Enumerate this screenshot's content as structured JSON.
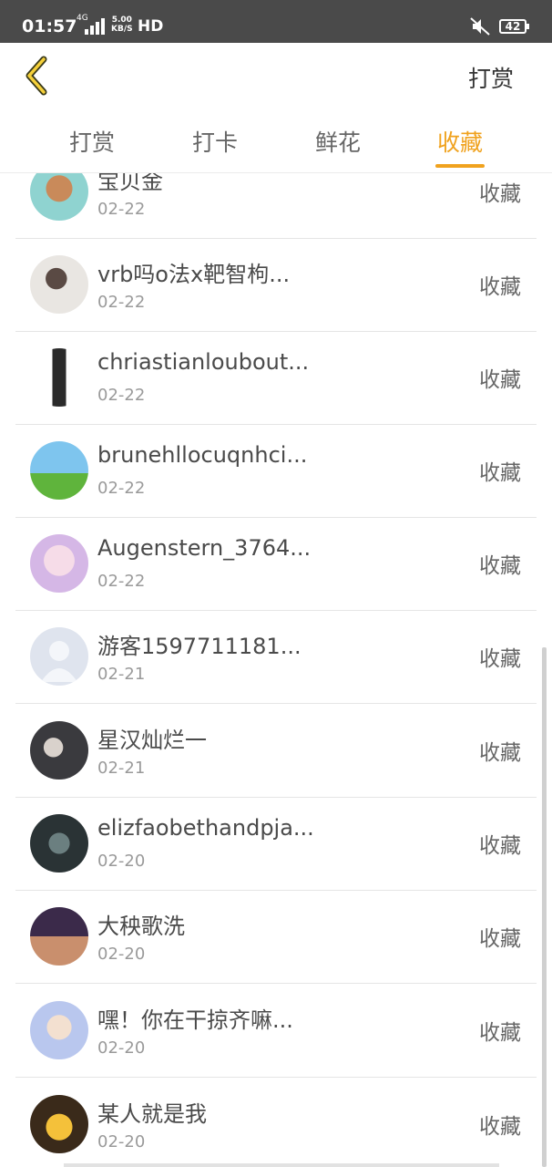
{
  "status_bar": {
    "time": "01:57",
    "network": "4G",
    "speed_top": "5.00",
    "speed_bottom": "KB/S",
    "hd": "HD",
    "battery": "42"
  },
  "header": {
    "back_icon": "chevron-left-icon",
    "title": "打赏"
  },
  "tabs": [
    {
      "label": "打赏",
      "active": false
    },
    {
      "label": "打卡",
      "active": false
    },
    {
      "label": "鲜花",
      "active": false
    },
    {
      "label": "收藏",
      "active": true
    }
  ],
  "colors": {
    "accent": "#f0a21e",
    "status_bar": "#4a4a4a"
  },
  "list": [
    {
      "name": "宝贝金",
      "date": "02-22",
      "action": "收藏"
    },
    {
      "name": "vrb吗o法x靶智枸...",
      "date": "02-22",
      "action": "收藏"
    },
    {
      "name": "chriastianloubout...",
      "date": "02-22",
      "action": "收藏"
    },
    {
      "name": "brunehllocuqnhci...",
      "date": "02-22",
      "action": "收藏"
    },
    {
      "name": "Augenstern_3764...",
      "date": "02-22",
      "action": "收藏"
    },
    {
      "name": "游客1597711181...",
      "date": "02-21",
      "action": "收藏"
    },
    {
      "name": "星汉灿烂一",
      "date": "02-21",
      "action": "收藏"
    },
    {
      "name": "elizfaobethandpja...",
      "date": "02-20",
      "action": "收藏"
    },
    {
      "name": "大秧歌洗",
      "date": "02-20",
      "action": "收藏"
    },
    {
      "name": "嘿！你在干掠齐嘛...",
      "date": "02-20",
      "action": "收藏"
    },
    {
      "name": "某人就是我",
      "date": "02-20",
      "action": "收藏"
    }
  ]
}
